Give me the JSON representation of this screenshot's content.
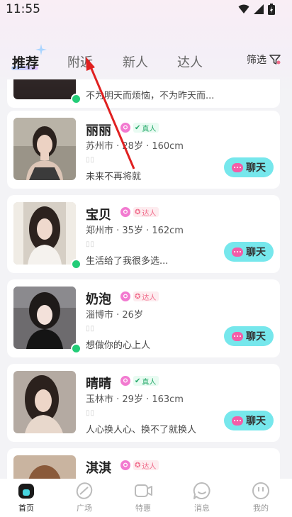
{
  "status_bar": {
    "time": "11:55"
  },
  "tabs": [
    {
      "label": "推荐",
      "active": true
    },
    {
      "label": "附近",
      "active": false
    },
    {
      "label": "新人",
      "active": false
    },
    {
      "label": "达人",
      "active": false
    }
  ],
  "filter_label": "筛选",
  "chat_label": "聊天",
  "partial_top": {
    "bio": "不为明天而烦恼，不为昨天而..."
  },
  "users": [
    {
      "name": "丽丽",
      "tag": "真人",
      "tag_type": "real",
      "info": "苏州市 · 28岁 · 160cm",
      "bio": "未来不再将就",
      "online": false
    },
    {
      "name": "宝贝",
      "tag": "达人",
      "tag_type": "expert",
      "info": "郑州市 · 35岁 · 162cm",
      "bio": "生活给了我很多选...",
      "online": true
    },
    {
      "name": "奶泡",
      "tag": "达人",
      "tag_type": "expert",
      "info": "淄博市 · 26岁",
      "bio": "想做你的心上人",
      "online": true
    },
    {
      "name": "晴晴",
      "tag": "真人",
      "tag_type": "real",
      "info": "玉林市 · 29岁 · 163cm",
      "bio": "人心换人心、换不了就换人",
      "online": false
    },
    {
      "name": "淇淇",
      "tag": "达人",
      "tag_type": "expert",
      "info": "",
      "bio": "",
      "online": false
    }
  ],
  "bottom_nav": [
    {
      "label": "首页",
      "icon": "home-icon",
      "active": true
    },
    {
      "label": "广场",
      "icon": "square-icon",
      "active": false
    },
    {
      "label": "特惠",
      "icon": "video-icon",
      "active": false
    },
    {
      "label": "消息",
      "icon": "message-icon",
      "active": false
    },
    {
      "label": "我的",
      "icon": "profile-icon",
      "active": false
    }
  ],
  "colors": {
    "chat_button": "#76e7ec",
    "online": "#22cc77",
    "gender": "#f27ad0",
    "arrow": "#e02020"
  }
}
